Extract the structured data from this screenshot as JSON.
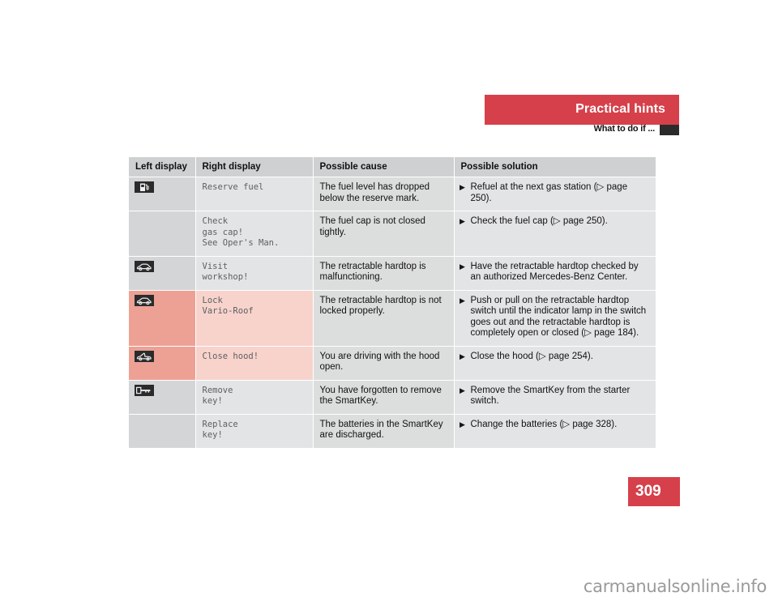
{
  "header": {
    "banner_title": "Practical hints",
    "subtitle": "What to do if ...",
    "banner_color": "#d6404a"
  },
  "table": {
    "columns": [
      "Left display",
      "Right display",
      "Possible cause",
      "Possible solution"
    ],
    "rows": [
      {
        "icon": "fuel-pump-icon",
        "left_display": "",
        "right_display": "Reserve fuel",
        "cause": "The fuel level has dropped below the reserve mark.",
        "solution": "Refuel at the next gas station (▷ page 250).",
        "marker": "▶",
        "tint": "gray"
      },
      {
        "icon": "",
        "left_display": "",
        "right_display": "Check\ngas cap!\nSee Oper's Man.",
        "cause": "The fuel cap is not closed tightly.",
        "solution": "Check the fuel cap (▷ page 250).",
        "marker": "▶",
        "tint": "gray"
      },
      {
        "icon": "convertible-car-icon",
        "left_display": "",
        "right_display": "Visit\nworkshop!",
        "cause": "The retractable hardtop is malfunctioning.",
        "solution": "Have the retractable hardtop checked by an authorized Mercedes-Benz Center.",
        "marker": "▶",
        "tint": "gray"
      },
      {
        "icon": "convertible-car-icon",
        "left_display": "",
        "right_display": "Lock\nVario-Roof",
        "cause": "The retractable hardtop is not locked properly.",
        "solution": "Push or pull on the retractable hardtop switch until the indicator lamp in the switch goes out and the retractable hardtop is completely open or closed (▷ page 184).",
        "marker": "▶",
        "tint": "pink"
      },
      {
        "icon": "hood-open-icon",
        "left_display": "",
        "right_display": "Close hood!",
        "cause": "You are driving with the hood open.",
        "solution": "Close the hood (▷ page 254).",
        "marker": "▶",
        "tint": "pink"
      },
      {
        "icon": "smartkey-icon",
        "left_display": "",
        "right_display": "Remove\nkey!",
        "cause": "You have forgotten to remove the SmartKey.",
        "solution": "Remove the SmartKey from the starter switch.",
        "marker": "▶",
        "tint": "gray"
      },
      {
        "icon": "",
        "left_display": "",
        "right_display": "Replace\nkey!",
        "cause": "The batteries in the SmartKey are discharged.",
        "solution": "Change the batteries (▷ page 328).",
        "marker": "▶",
        "tint": "gray"
      }
    ]
  },
  "page_number": "309",
  "watermark": "carmanualsonline.info"
}
